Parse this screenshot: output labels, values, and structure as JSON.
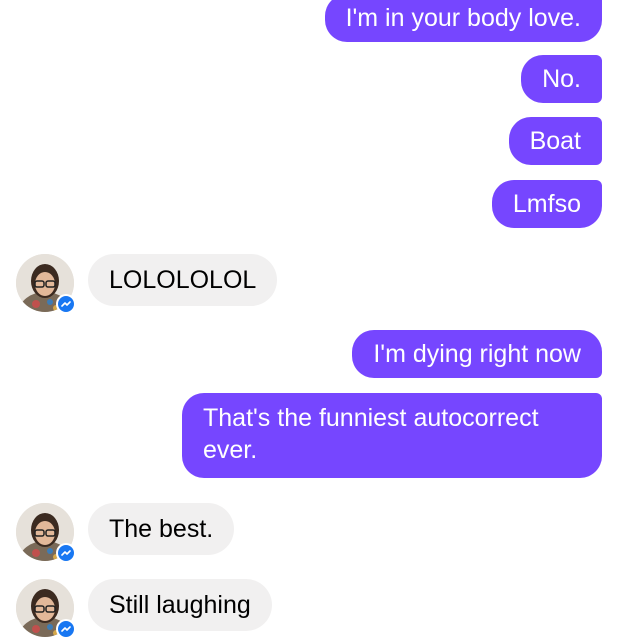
{
  "conversation": {
    "messages": [
      {
        "side": "sent",
        "text": "I'm in your body love."
      },
      {
        "side": "sent",
        "text": "No."
      },
      {
        "side": "sent",
        "text": "Boat"
      },
      {
        "side": "sent",
        "text": "Lmfso"
      },
      {
        "side": "received",
        "text": "LOLOLOLOL"
      },
      {
        "side": "sent",
        "text": "I'm dying right now"
      },
      {
        "side": "sent",
        "text": "That's the funniest autocorrect ever."
      },
      {
        "side": "received",
        "text": "The best."
      },
      {
        "side": "received",
        "text": "Still laughing"
      }
    ]
  },
  "colors": {
    "sent_bubble": "#7646ff",
    "received_bubble": "#f1f0f0",
    "messenger_badge": "#1877f2"
  },
  "icons": {
    "avatar": "contact-avatar",
    "badge": "messenger-badge-icon"
  }
}
